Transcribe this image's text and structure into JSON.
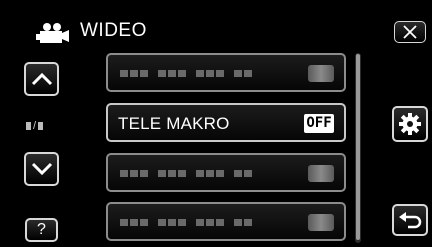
{
  "header": {
    "title": "WIDEO",
    "mode_icon": "video-camera-icon"
  },
  "left_controls": {
    "up_icon": "chevron-up-icon",
    "page_indicator": "/",
    "down_icon": "chevron-down-icon",
    "help_label": "?"
  },
  "right_controls": {
    "close_icon": "close-icon",
    "settings_icon": "gear-icon",
    "back_icon": "return-icon"
  },
  "menu": {
    "items": [
      {
        "label": "",
        "value": ""
      },
      {
        "label": "TELE MAKRO",
        "value": "OFF"
      },
      {
        "label": "",
        "value": ""
      },
      {
        "label": "",
        "value": ""
      }
    ]
  },
  "colors": {
    "background": "#000000",
    "border": "#d8d8d8",
    "text": "#ffffff"
  }
}
